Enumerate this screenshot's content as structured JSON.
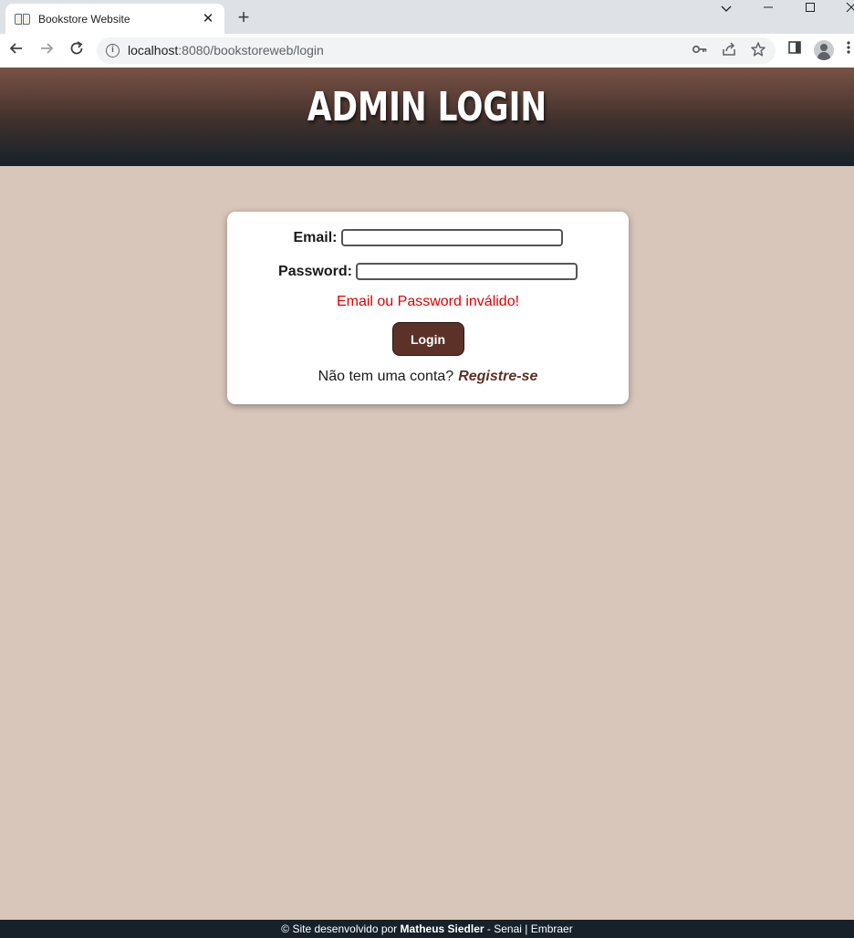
{
  "browser": {
    "tab_title": "Bookstore Website",
    "tab_close": "✕",
    "new_tab": "+",
    "url_host": "localhost",
    "url_path": ":8080/bookstoreweb/login"
  },
  "page": {
    "title": "Admin Login",
    "form": {
      "email_label": "Email:",
      "email_value": "",
      "password_label": "Password:",
      "password_value": "",
      "error_message": "Email ou Password inválido!",
      "login_button": "Login",
      "register_prompt": "Não tem uma conta?",
      "register_link": "Registre-se"
    }
  },
  "footer": {
    "prefix": "© Site desenvolvido por",
    "author": "Matheus Siedler",
    "suffix": "- Senai | Embraer"
  },
  "colors": {
    "background": "#d8c6ba",
    "accent": "#5b3128",
    "error": "#e00000",
    "dark": "#16212a"
  }
}
